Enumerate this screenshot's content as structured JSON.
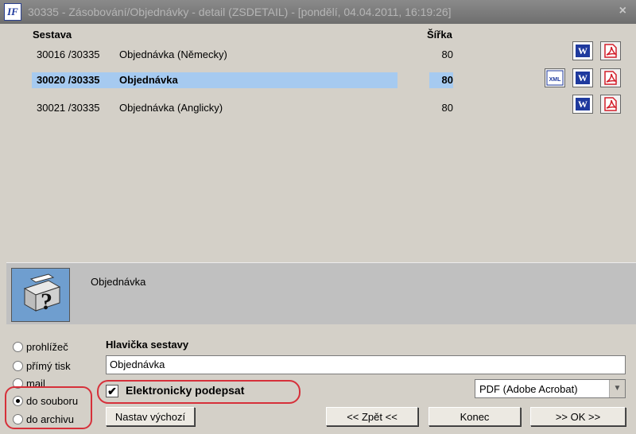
{
  "window": {
    "title": "30335 - Zásobování/Objednávky - detail (ZSDETAIL) - [pondělí, 04.04.2011, 16:19:26]",
    "icon_text": "IF",
    "close_label": "×"
  },
  "columns": {
    "report": "Sestava",
    "width": "Šířka"
  },
  "reports": [
    {
      "number": "30016  /30335",
      "name": "Objednávka (Německy)",
      "width": "80",
      "selected": false
    },
    {
      "number": "30020  /30335",
      "name": "Objednávka",
      "width": "80",
      "selected": true
    },
    {
      "number": "30021  /30335",
      "name": "Objednávka (Anglicky)",
      "width": "80",
      "selected": false
    }
  ],
  "icons": {
    "word": "W",
    "xml": "XML"
  },
  "description": {
    "text": "Objednávka",
    "icon": "printer-question-icon"
  },
  "output_options": [
    {
      "label": "prohlížeč",
      "selected": false
    },
    {
      "label": "přímý tisk",
      "selected": false
    },
    {
      "label": "mail",
      "selected": false
    },
    {
      "label": "do souboru",
      "selected": true
    },
    {
      "label": "do archivu",
      "selected": false
    }
  ],
  "header_section": {
    "title": "Hlavička sestavy",
    "value": "Objednávka"
  },
  "sign": {
    "label": "Elektronicky podepsat",
    "checked": true,
    "mark": "✔"
  },
  "format_select": {
    "value": "PDF (Adobe Acrobat)",
    "arrow": "▼"
  },
  "buttons": {
    "set_default": "Nastav výchozí",
    "back": "<< Zpět <<",
    "end": "Konec",
    "ok": ">> OK >>"
  },
  "colors": {
    "selection": "#a6caf0",
    "highlight_ring": "#d6303a",
    "word_blue": "#1f3a9e",
    "pdf_red": "#d21e2a"
  }
}
